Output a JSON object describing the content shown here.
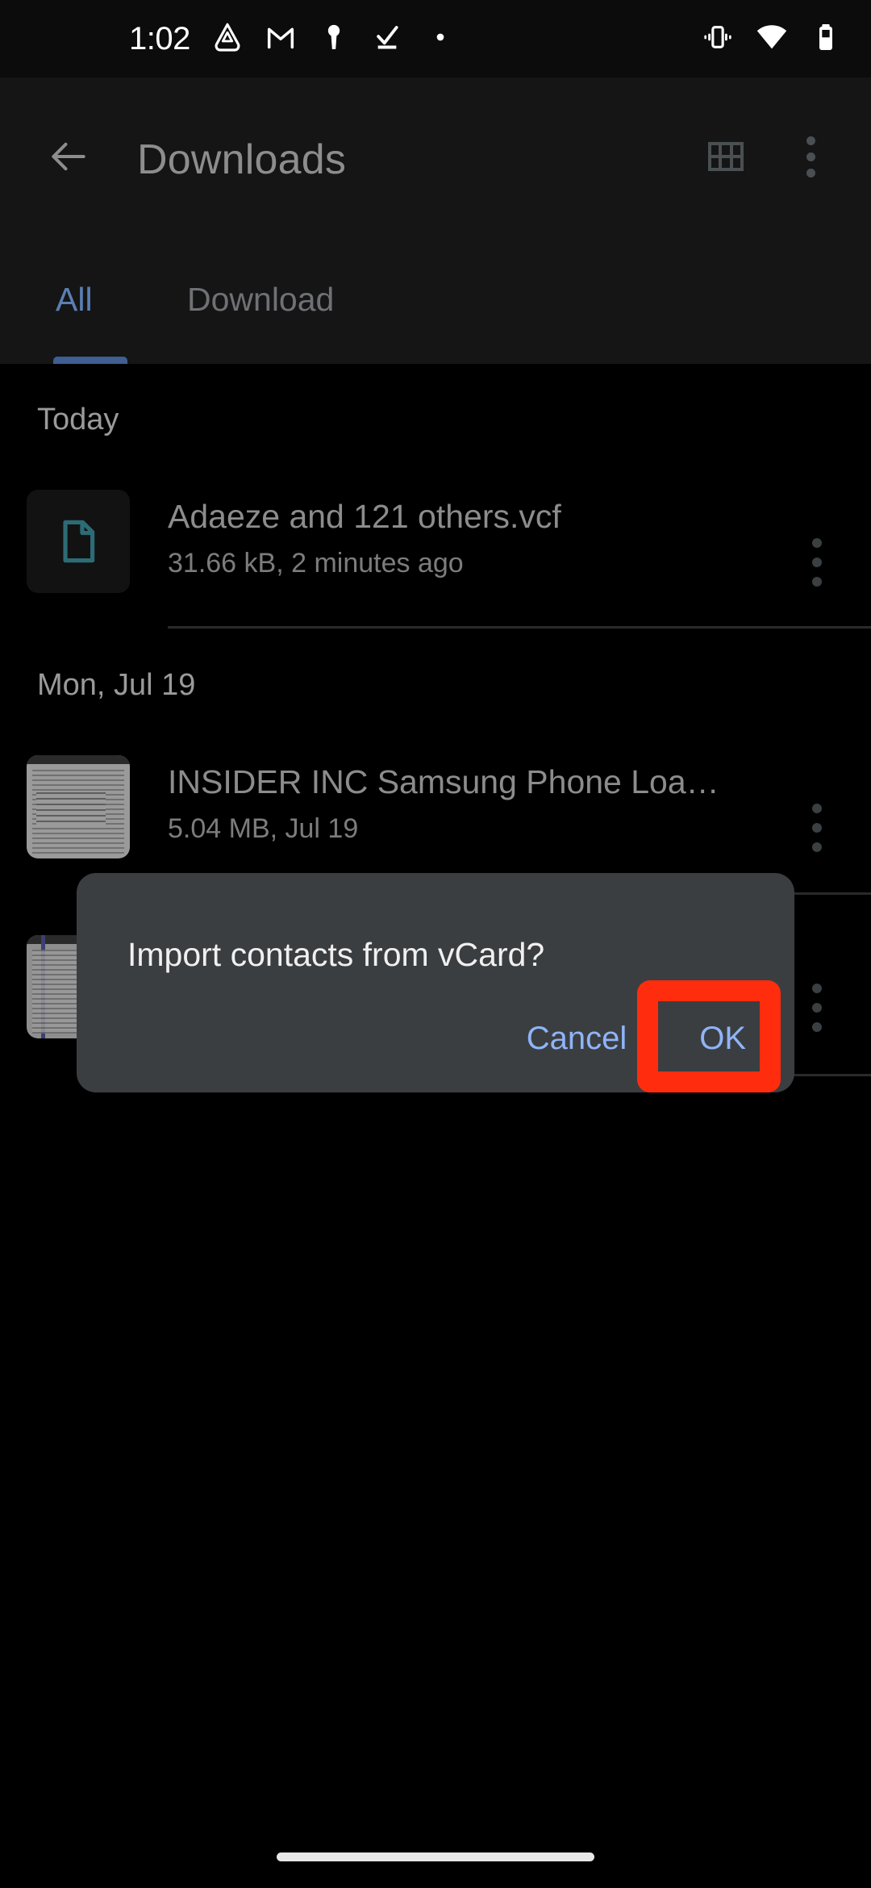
{
  "status_bar": {
    "time": "1:02",
    "left_icons": [
      {
        "name": "drive-icon",
        "label": "Google Drive"
      },
      {
        "name": "gmail-icon",
        "label": "Gmail"
      },
      {
        "name": "keyhole-icon",
        "label": "VPN"
      },
      {
        "name": "checkmark-icon",
        "label": "Tasks"
      },
      {
        "name": "dot-icon",
        "label": "More notifications"
      }
    ],
    "right_icons": [
      {
        "name": "vibrate-icon",
        "label": "Vibrate"
      },
      {
        "name": "wifi-icon",
        "label": "Wi-Fi"
      },
      {
        "name": "battery-icon",
        "label": "Battery"
      }
    ]
  },
  "app_bar": {
    "title": "Downloads",
    "back_label": "Navigate up",
    "grid_view_label": "Grid view",
    "overflow_label": "More options"
  },
  "tabs": [
    {
      "label": "All",
      "selected": true
    },
    {
      "label": "Download",
      "selected": false
    }
  ],
  "list": {
    "sections": [
      {
        "header": "Today",
        "items": [
          {
            "title": "Adaeze and 121 others.vcf",
            "subtitle": "31.66 kB, 2 minutes ago",
            "thumb": "vcard-file-icon"
          }
        ]
      },
      {
        "header": "Mon, Jul 19",
        "items": [
          {
            "title": "INSIDER INC Samsung Phone Loa…",
            "subtitle": "5.04 MB, Jul 19",
            "thumb": "document-thumbnail"
          },
          {
            "title": "",
            "subtitle": "",
            "thumb": "document-thumbnail"
          }
        ]
      }
    ],
    "item_menu_label": "More options"
  },
  "dialog": {
    "message": "Import contacts from vCard?",
    "cancel_label": "Cancel",
    "ok_label": "OK"
  },
  "colors": {
    "accent_blue": "#8fb4f8",
    "tab_selected": "#5b7fb5",
    "highlight_red": "#ff2d0e",
    "dialog_bg": "#3b3e41",
    "file_icon_teal": "#2d6b75"
  },
  "nav": {
    "pill_label": "Home gesture bar"
  }
}
